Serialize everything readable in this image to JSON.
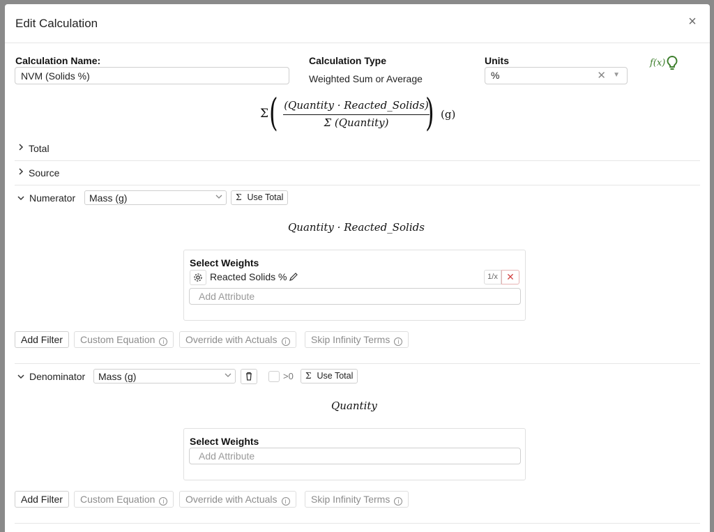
{
  "modal": {
    "title": "Edit Calculation",
    "close_glyph": "×"
  },
  "name_field": {
    "label": "Calculation Name:",
    "value": "NVM (Solids %)"
  },
  "calc_type": {
    "label": "Calculation Type",
    "value": "Weighted Sum or Average"
  },
  "units": {
    "label": "Units",
    "value": "%",
    "clear_glyph": "✕",
    "caret_glyph": "▼"
  },
  "tools": {
    "fx_label": "f(x)",
    "bulb_icon": "lightbulb-icon"
  },
  "formula": {
    "sigma": "Σ",
    "numerator": "(Quantity · Reacted_Solids)",
    "denominator": "Σ (Quantity)",
    "unit": "(g)"
  },
  "sections": {
    "total": "Total",
    "source": "Source"
  },
  "numerator": {
    "label": "Numerator",
    "select_value": "Mass (g)",
    "use_total_sigma": "Σ",
    "use_total": "Use Total",
    "formula": "Quantity · Reacted_Solids",
    "weights_title": "Select Weights",
    "weight_item": "Reacted Solids %",
    "recip_label": "1/x",
    "remove_glyph": "✕",
    "attr_placeholder": "Add Attribute"
  },
  "denominator": {
    "label": "Denominator",
    "select_value": "Mass (g)",
    "gt_zero": ">0",
    "use_total_sigma": "Σ",
    "use_total": "Use Total",
    "formula": "Quantity",
    "weights_title": "Select Weights",
    "attr_placeholder": "Add Attribute"
  },
  "actions": {
    "add_filter": "Add Filter",
    "custom_equation": "Custom Equation",
    "override": "Override with Actuals",
    "skip_infinity": "Skip Infinity Terms",
    "info_glyph": "i"
  }
}
